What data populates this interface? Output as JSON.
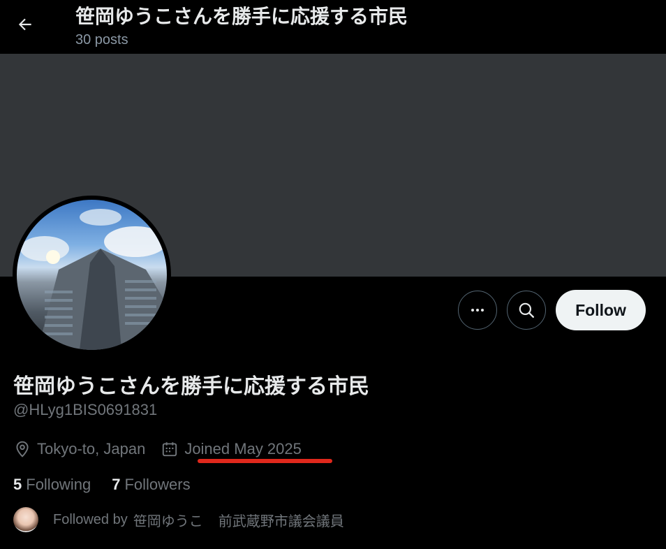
{
  "header": {
    "title": "笹岡ゆうこさんを勝手に応援する市民",
    "posts_count": "30 posts"
  },
  "profile": {
    "display_name": "笹岡ゆうこさんを勝手に応援する市民",
    "handle": "@HLyg1BIS0691831",
    "location": "Tokyo-to, Japan",
    "joined": "Joined May 2025",
    "following_count": "5",
    "following_label": "Following",
    "followers_count": "7",
    "followers_label": "Followers",
    "followed_by_prefix": "Followed by",
    "followed_by_name": "笹岡ゆうこ",
    "followed_by_title": "前武蔵野市議会議員"
  },
  "actions": {
    "follow_label": "Follow"
  },
  "icons": {
    "back": "arrow-left-icon",
    "more": "more-dots-icon",
    "search": "search-icon",
    "location": "location-pin-icon",
    "calendar": "calendar-icon"
  },
  "colors": {
    "background": "#000000",
    "banner": "#333639",
    "text_primary": "#e7e9ea",
    "text_secondary": "#71767b",
    "follow_button_bg": "#eff3f4",
    "highlight_underline": "#e0281c"
  }
}
